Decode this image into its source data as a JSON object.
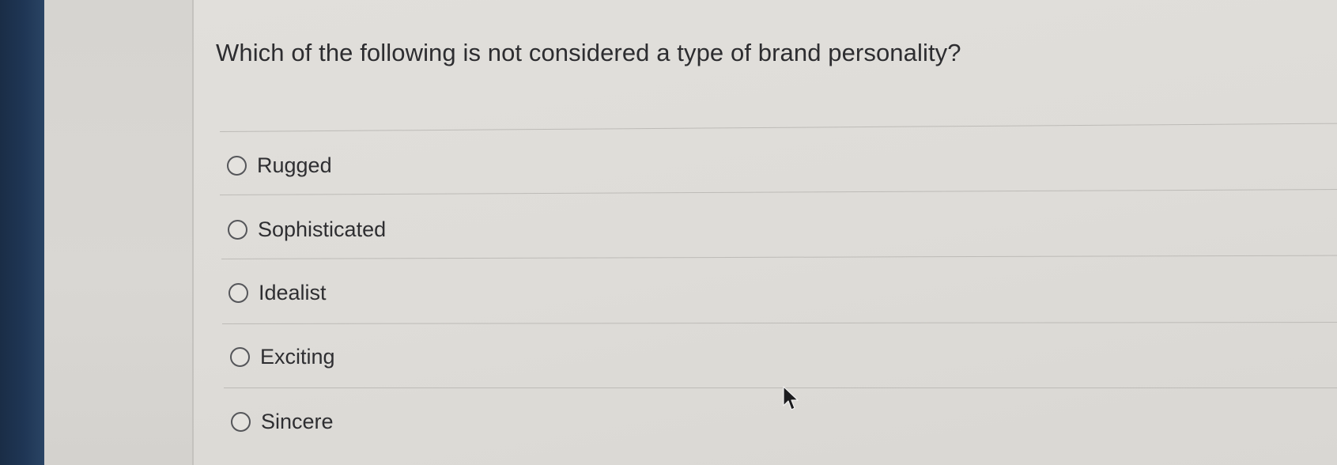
{
  "question": {
    "text": "Which of the following is not considered a type of brand personality?"
  },
  "options": [
    {
      "label": "Rugged",
      "selected": false
    },
    {
      "label": "Sophisticated",
      "selected": false
    },
    {
      "label": "Idealist",
      "selected": false
    },
    {
      "label": "Exciting",
      "selected": false
    },
    {
      "label": "Sincere",
      "selected": false
    }
  ],
  "icons": {
    "radio": "radio-button-icon",
    "cursor": "mouse-pointer-icon"
  },
  "colors": {
    "background": "#dedcd8",
    "bezel": "#1f3655",
    "text": "#2d2d30",
    "divider": "#bdbbb7"
  }
}
